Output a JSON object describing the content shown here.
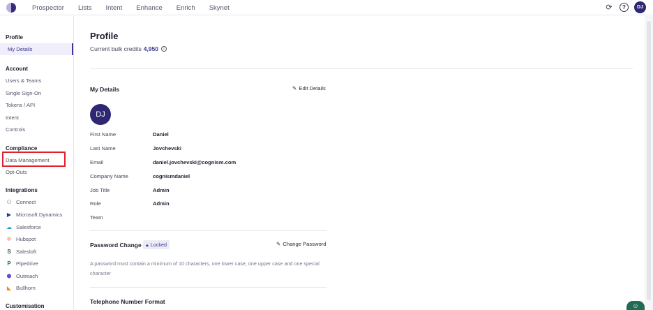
{
  "topbar": {
    "nav": [
      "Prospector",
      "Lists",
      "Intent",
      "Enhance",
      "Enrich",
      "Skynet"
    ],
    "user_initials": "DJ",
    "icons": [
      "refresh-icon",
      "help-icon"
    ]
  },
  "sidebar": {
    "sections": [
      {
        "title": "Profile",
        "items": [
          "My Details"
        ]
      },
      {
        "title": "Account",
        "items": [
          "Users & Teams",
          "Single Sign-On",
          "Tokens / API",
          "Intent",
          "Controls"
        ]
      },
      {
        "title": "Compliance",
        "items": [
          "Data Management",
          "Opt-Outs"
        ]
      },
      {
        "title": "Integrations",
        "items": [
          "Connect",
          "Microsoft Dynamics",
          "Salesforce",
          "Hubspot",
          "Salesloft",
          "Pipedrive",
          "Outreach",
          "Bullhorn"
        ]
      },
      {
        "title": "Customisation",
        "items": []
      }
    ],
    "active_item": "My Details",
    "highlighted_item": "Data Management"
  },
  "main": {
    "title": "Profile",
    "credits_label": "Current bulk credits",
    "credits_value": "4,950",
    "details": {
      "title": "My Details",
      "edit_label": "Edit Details",
      "avatar_initials": "DJ",
      "fields": [
        {
          "label": "First Name",
          "value": "Daniel"
        },
        {
          "label": "Last Name",
          "value": "Jovchevski"
        },
        {
          "label": "Email",
          "value": "daniel.jovchevski@cognism.com"
        },
        {
          "label": "Company Name",
          "value": "cognismdaniel"
        },
        {
          "label": "Job Title",
          "value": "Admin"
        },
        {
          "label": "Role",
          "value": "Admin"
        },
        {
          "label": "Team",
          "value": ""
        }
      ]
    },
    "password": {
      "title": "Password Change",
      "locked_label": "Locked",
      "change_label": "Change Password",
      "note": "A password must contain a minimum of 10 characters, one lower case, one upper case and one special character"
    },
    "phone_format": {
      "title": "Telephone Number Format"
    }
  },
  "colors": {
    "accent": "#3b3593",
    "avatar": "#2e2771",
    "highlight": "#e0202a"
  }
}
